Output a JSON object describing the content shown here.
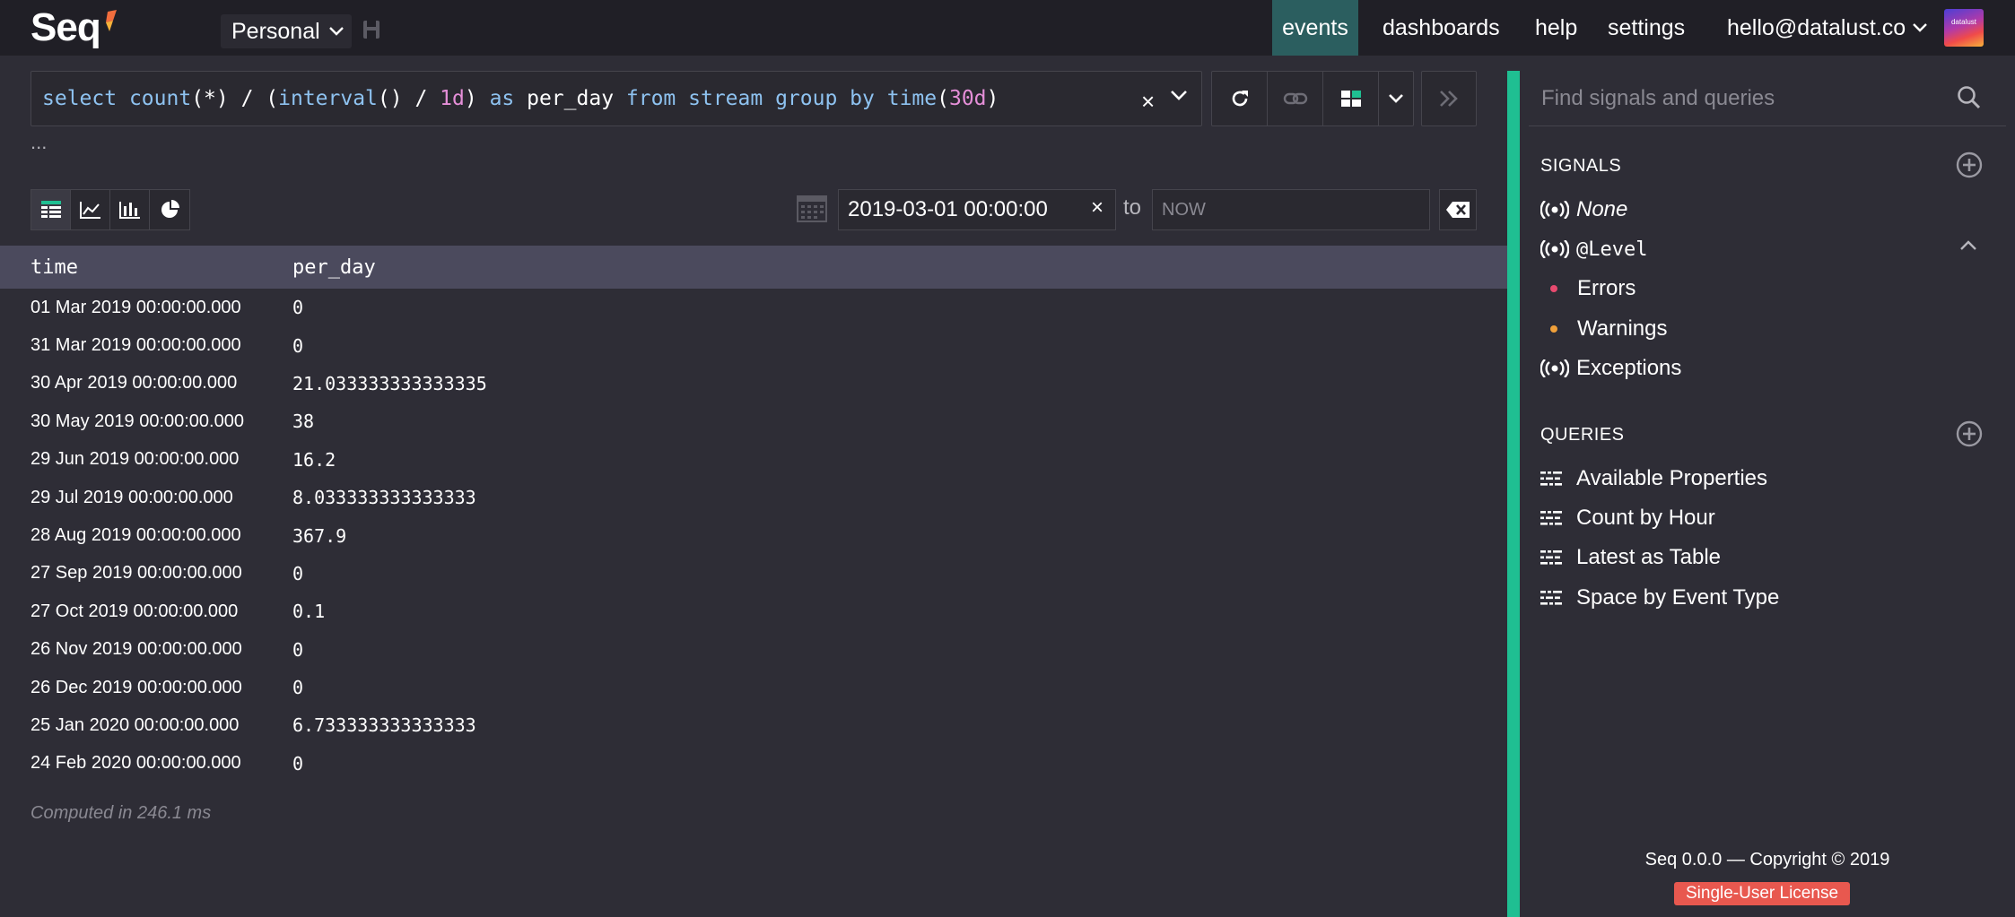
{
  "topbar": {
    "logo": "Seq",
    "workspace": "Personal",
    "nav": {
      "events": "events",
      "dashboards": "dashboards",
      "help": "help",
      "settings": "settings",
      "user": "hello@datalust.co"
    },
    "avatar_text": "datalust"
  },
  "query": {
    "tokens": [
      {
        "text": "select ",
        "kind": "kw"
      },
      {
        "text": "count",
        "kind": "fn"
      },
      {
        "text": "(*) / (",
        "kind": "plain"
      },
      {
        "text": "interval",
        "kind": "fn"
      },
      {
        "text": "() / ",
        "kind": "plain"
      },
      {
        "text": "1d",
        "kind": "num"
      },
      {
        "text": ") ",
        "kind": "plain"
      },
      {
        "text": "as ",
        "kind": "kw"
      },
      {
        "text": "per_day ",
        "kind": "plain"
      },
      {
        "text": "from ",
        "kind": "kw"
      },
      {
        "text": "stream ",
        "kind": "fn"
      },
      {
        "text": "group ",
        "kind": "kw"
      },
      {
        "text": "by ",
        "kind": "kw"
      },
      {
        "text": "time",
        "kind": "fn"
      },
      {
        "text": "(",
        "kind": "plain"
      },
      {
        "text": "30d",
        "kind": "num"
      },
      {
        "text": ")",
        "kind": "plain"
      }
    ],
    "clear_glyph": "×",
    "ellipsis": "..."
  },
  "range": {
    "from": "2019-03-01 00:00:00",
    "clear_glyph": "×",
    "to_label": "to",
    "to_placeholder": "NOW"
  },
  "results": {
    "columns": [
      "time",
      "per_day"
    ],
    "rows": [
      {
        "time": "01 Mar 2019 00:00:00.000",
        "value": "0"
      },
      {
        "time": "31 Mar 2019 00:00:00.000",
        "value": "0"
      },
      {
        "time": "30 Apr 2019 00:00:00.000",
        "value": "21.033333333333335"
      },
      {
        "time": "30 May 2019 00:00:00.000",
        "value": "38"
      },
      {
        "time": "29 Jun 2019 00:00:00.000",
        "value": "16.2"
      },
      {
        "time": "29 Jul 2019 00:00:00.000",
        "value": "8.033333333333333"
      },
      {
        "time": "28 Aug 2019 00:00:00.000",
        "value": "367.9"
      },
      {
        "time": "27 Sep 2019 00:00:00.000",
        "value": "0"
      },
      {
        "time": "27 Oct 2019 00:00:00.000",
        "value": "0.1"
      },
      {
        "time": "26 Nov 2019 00:00:00.000",
        "value": "0"
      },
      {
        "time": "26 Dec 2019 00:00:00.000",
        "value": "0"
      },
      {
        "time": "25 Jan 2020 00:00:00.000",
        "value": "6.733333333333333"
      },
      {
        "time": "24 Feb 2020 00:00:00.000",
        "value": "0"
      }
    ],
    "computed": "Computed in 246.1 ms"
  },
  "side": {
    "search_placeholder": "Find signals and queries",
    "signals_title": "SIGNALS",
    "signals": {
      "none": "None",
      "level": "@Level",
      "errors": "Errors",
      "warnings": "Warnings",
      "exceptions": "Exceptions"
    },
    "queries_title": "QUERIES",
    "queries": [
      "Available Properties",
      "Count by Hour",
      "Latest as Table",
      "Space by Event Type"
    ],
    "footer": "Seq 0.0.0 — Copyright © 2019",
    "license": "Single-User License"
  },
  "colors": {
    "accent": "#1fbf92",
    "active_nav": "#2b5e5f",
    "error_dot": "#e84a6f",
    "warning_dot": "#f0a03a",
    "license": "#e8584f",
    "header_row": "#4b4a5d"
  },
  "icons": {
    "signal": "broadcast-icon",
    "query": "query-list-icon",
    "add": "add-circle-icon",
    "search": "search-icon"
  }
}
